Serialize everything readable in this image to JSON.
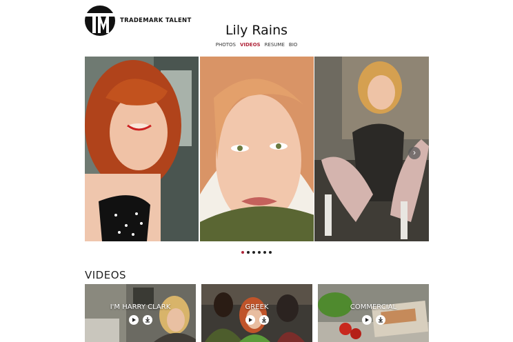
{
  "brand": {
    "name": "TRADEMARK TALENT",
    "logo_letters": "TM",
    "accent_color": "#b0253a"
  },
  "profile": {
    "name": "Lily Rains"
  },
  "nav": {
    "items": [
      {
        "label": "PHOTOS"
      },
      {
        "label": "VIDEOS",
        "active": true
      },
      {
        "label": "RESUME"
      },
      {
        "label": "BIO"
      }
    ]
  },
  "gallery": {
    "next_icon": "chevron-right-icon",
    "slide_count": 6,
    "active_slide": 1
  },
  "videos_section": {
    "title": "VIDEOS",
    "items": [
      {
        "label": "I'M HARRY CLARK"
      },
      {
        "label": "GREEK"
      },
      {
        "label": "COMMERCIAL"
      }
    ]
  }
}
